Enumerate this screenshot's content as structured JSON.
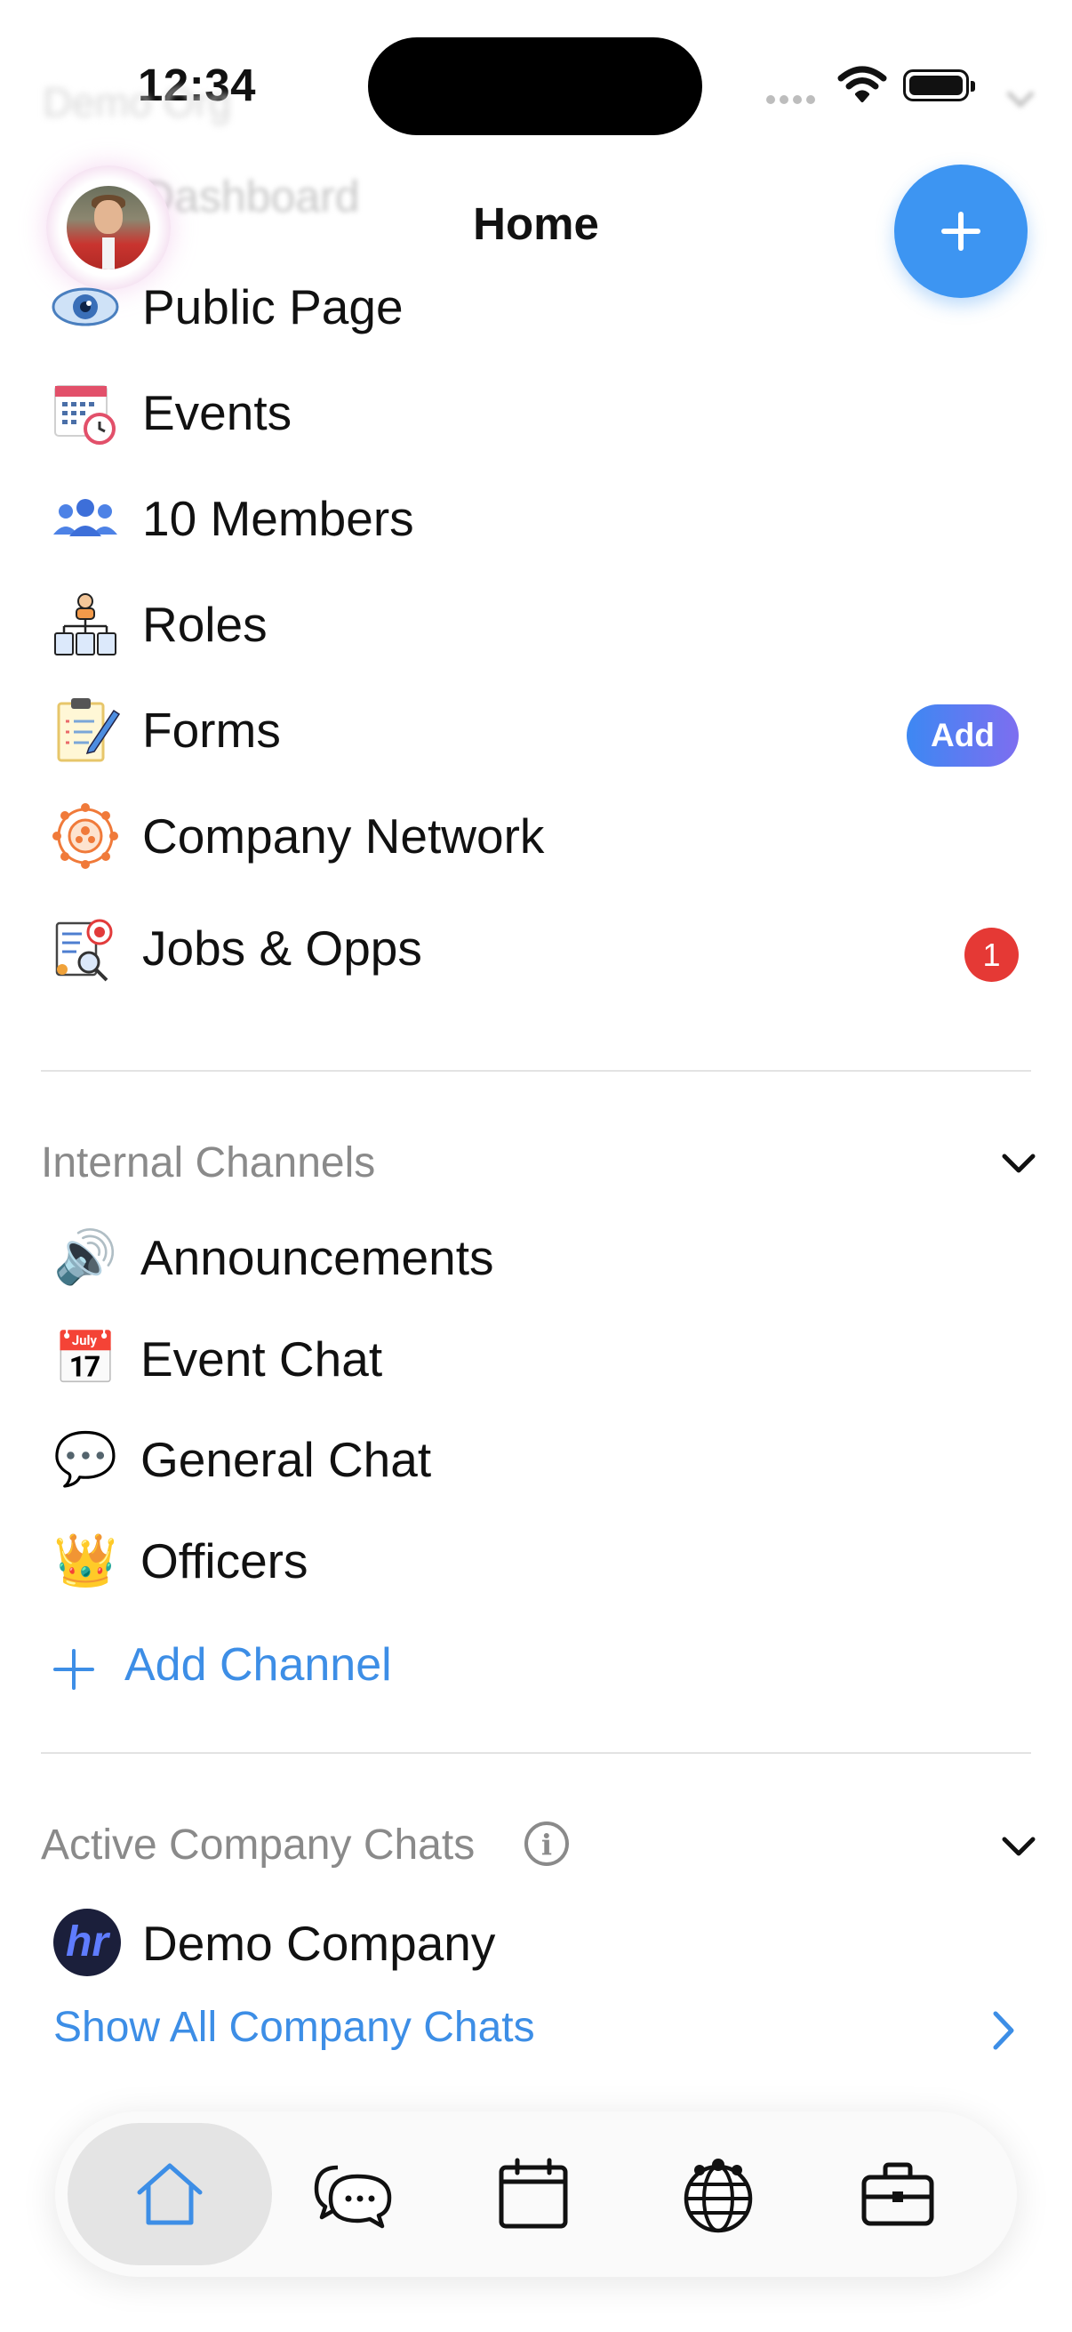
{
  "status_bar": {
    "time": "12:34"
  },
  "behind_header": {
    "org_name": "Demo Org",
    "first_item": "Dashboard"
  },
  "header": {
    "title": "Home"
  },
  "menu": [
    {
      "id": "public-page",
      "label": "Public Page",
      "icon": "eye-icon"
    },
    {
      "id": "events",
      "label": "Events",
      "icon": "calendar-clock-icon"
    },
    {
      "id": "members",
      "label": "10 Members",
      "icon": "people-icon"
    },
    {
      "id": "roles",
      "label": "Roles",
      "icon": "org-chart-icon"
    },
    {
      "id": "forms",
      "label": "Forms",
      "icon": "clipboard-pencil-icon",
      "action": "Add"
    },
    {
      "id": "company-network",
      "label": "Company Network",
      "icon": "network-icon"
    },
    {
      "id": "jobs-opps",
      "label": "Jobs & Opps",
      "icon": "target-search-icon",
      "badge": "1"
    }
  ],
  "internal_channels": {
    "title": "Internal Channels",
    "channels": [
      {
        "emoji": "🔊",
        "label": "Announcements"
      },
      {
        "emoji": "📅",
        "label": "Event Chat"
      },
      {
        "emoji": "💬",
        "label": "General Chat"
      },
      {
        "emoji": "👑",
        "label": "Officers"
      }
    ],
    "add_label": "Add Channel"
  },
  "company_chats": {
    "title": "Active Company Chats",
    "companies": [
      {
        "logo_text": "hr",
        "label": "Demo Company"
      }
    ],
    "show_all": "Show All Company Chats"
  },
  "tab_bar": {
    "tabs": [
      "home-icon",
      "chat-bubbles-icon",
      "calendar-icon",
      "globe-people-icon",
      "briefcase-icon"
    ],
    "active": "home-icon"
  },
  "colors": {
    "accent": "#3d95f2",
    "link": "#3d8ee6",
    "badge": "#e53935",
    "muted": "#8a8a8a"
  }
}
